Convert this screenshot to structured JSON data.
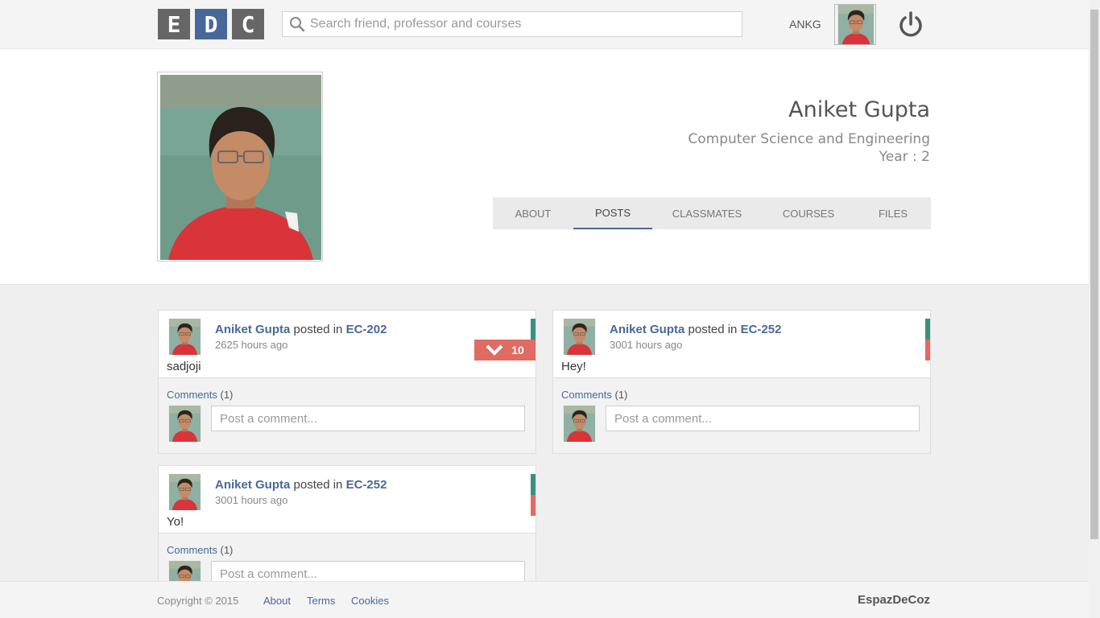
{
  "header": {
    "logo": [
      "E",
      "D",
      "C"
    ],
    "search_placeholder": "Search friend, professor and courses",
    "username": "ANKG"
  },
  "profile": {
    "name": "Aniket Gupta",
    "department": "Computer Science and Engineering",
    "year": "Year : 2",
    "tabs": [
      {
        "label": "ABOUT",
        "active": false
      },
      {
        "label": "POSTS",
        "active": true
      },
      {
        "label": "CLASSMATES",
        "active": false
      },
      {
        "label": "COURSES",
        "active": false
      },
      {
        "label": "FILES",
        "active": false
      }
    ]
  },
  "posts": [
    {
      "author": "Aniket Gupta",
      "posted_in": "posted in",
      "course": "EC-202",
      "time": "2625 hours ago",
      "text": "sadjoji",
      "votes": "10",
      "comments_label": "Comments",
      "comments_count": "(1)",
      "comment_placeholder": "Post a comment..."
    },
    {
      "author": "Aniket Gupta",
      "posted_in": "posted in",
      "course": "EC-252",
      "time": "3001 hours ago",
      "text": "Hey!",
      "comments_label": "Comments",
      "comments_count": "(1)",
      "comment_placeholder": "Post a comment..."
    },
    {
      "author": "Aniket Gupta",
      "posted_in": "posted in",
      "course": "EC-252",
      "time": "3001 hours ago",
      "text": "Yo!",
      "comments_label": "Comments",
      "comments_count": "(1)",
      "comment_placeholder": "Post a comment..."
    }
  ],
  "footer": {
    "copyright": "Copyright © 2015",
    "links": [
      "About",
      "Terms",
      "Cookies"
    ],
    "brand": "EspazDeCoz"
  },
  "colors": {
    "accent": "#48689a",
    "upvote": "#3a8f7f",
    "downvote": "#df6b63"
  }
}
